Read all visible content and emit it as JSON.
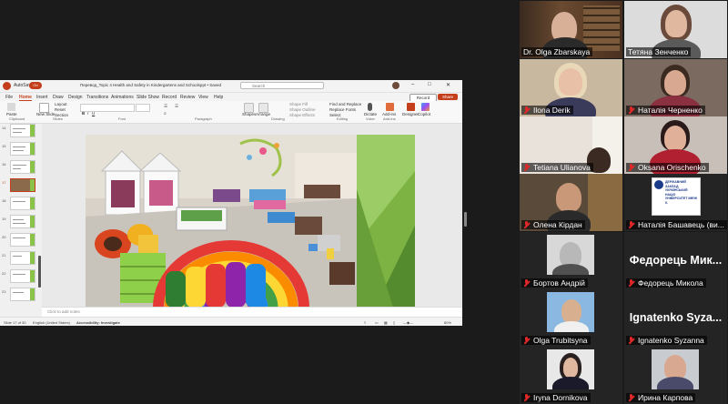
{
  "powerpoint": {
    "autosave_label": "AutoSave",
    "autosave_state": "On",
    "doc_title": "Перевод_Topic 4 Health and Safety in Kindergartens and Schoolsppt • Saved",
    "search_placeholder": "Search",
    "tabs": [
      "File",
      "Home",
      "Insert",
      "Draw",
      "Design",
      "Transitions",
      "Animations",
      "Slide Show",
      "Record",
      "Review",
      "View",
      "Help"
    ],
    "active_tab": "Home",
    "record_label": "Record",
    "share_label": "Share",
    "ribbon": {
      "paste": "Paste",
      "new_slide": "New Slide",
      "layout": "Layout",
      "reset": "Reset",
      "section": "Section",
      "shapes": "Shapes",
      "arrange": "Arrange",
      "shape_fill": "Shape Fill",
      "shape_outline": "Shape Outline",
      "shape_effects": "Shape Effects",
      "find_replace": "Find and Replace",
      "replace_fonts": "Replace Fonts",
      "select": "Select",
      "dictate": "Dictate",
      "addins": "Add-ins",
      "designer": "Designer",
      "copilot": "Copilot",
      "groups": [
        "Clipboard",
        "Slides",
        "Font",
        "Paragraph",
        "Drawing",
        "Editing",
        "Voice",
        "Add-ins"
      ]
    },
    "thumbnail_numbers": [
      "14",
      "15",
      "16",
      "17",
      "18",
      "19",
      "20",
      "21",
      "22",
      "23"
    ],
    "selected_slide": "17",
    "notes_placeholder": "Click to add notes",
    "status": {
      "slide_of": "Slide 17 of 30",
      "language": "English (United States)",
      "accessibility": "Accessibility: Investigate",
      "zoom": "80%"
    }
  },
  "participants": [
    {
      "name": "Dr. Olga Zbarskaya",
      "type": "video",
      "muted": false,
      "active": true
    },
    {
      "name": "Тетяна Зенченко",
      "type": "video",
      "muted": false,
      "active": false
    },
    {
      "name": "Ilona Derik",
      "type": "video",
      "muted": true,
      "active": false
    },
    {
      "name": "Наталія Черненко",
      "type": "video",
      "muted": true,
      "active": false
    },
    {
      "name": "Tetiana Ulianova",
      "type": "video",
      "muted": true,
      "active": false
    },
    {
      "name": "Oksana Orischenko",
      "type": "video",
      "muted": true,
      "active": false
    },
    {
      "name": "Олена Кірдан",
      "type": "video",
      "muted": true,
      "active": false
    },
    {
      "name": "Наталія Башавець (ви...",
      "type": "logo",
      "muted": true,
      "active": false,
      "logo_text": "ДЕРЖАВНИЙ ЗАКЛАД УКРАЇНСЬКИЙ НАЦІО УНІВЕРСИТЕТ ІМЕНІ К."
    },
    {
      "name": "Бортов Андрій",
      "type": "photo",
      "muted": true,
      "active": false
    },
    {
      "name": "Федорець Микола",
      "type": "name",
      "muted": true,
      "active": false,
      "display": "Федорець Мик..."
    },
    {
      "name": "Olga Trubitsyna",
      "type": "photo",
      "muted": true,
      "active": false
    },
    {
      "name": "Ignatenko Syzanna",
      "type": "name",
      "muted": true,
      "active": false,
      "display": "Ignatenko Syza..."
    },
    {
      "name": "Iryna Dornikova",
      "type": "photo",
      "muted": true,
      "active": false
    },
    {
      "name": "Ирина Карпова",
      "type": "photo",
      "muted": true,
      "active": false
    }
  ],
  "colors": {
    "ppt_accent": "#c43e1c",
    "slide_green": "#7cb342",
    "active_speaker": "#2eb82e",
    "muted_red": "#e02828"
  }
}
